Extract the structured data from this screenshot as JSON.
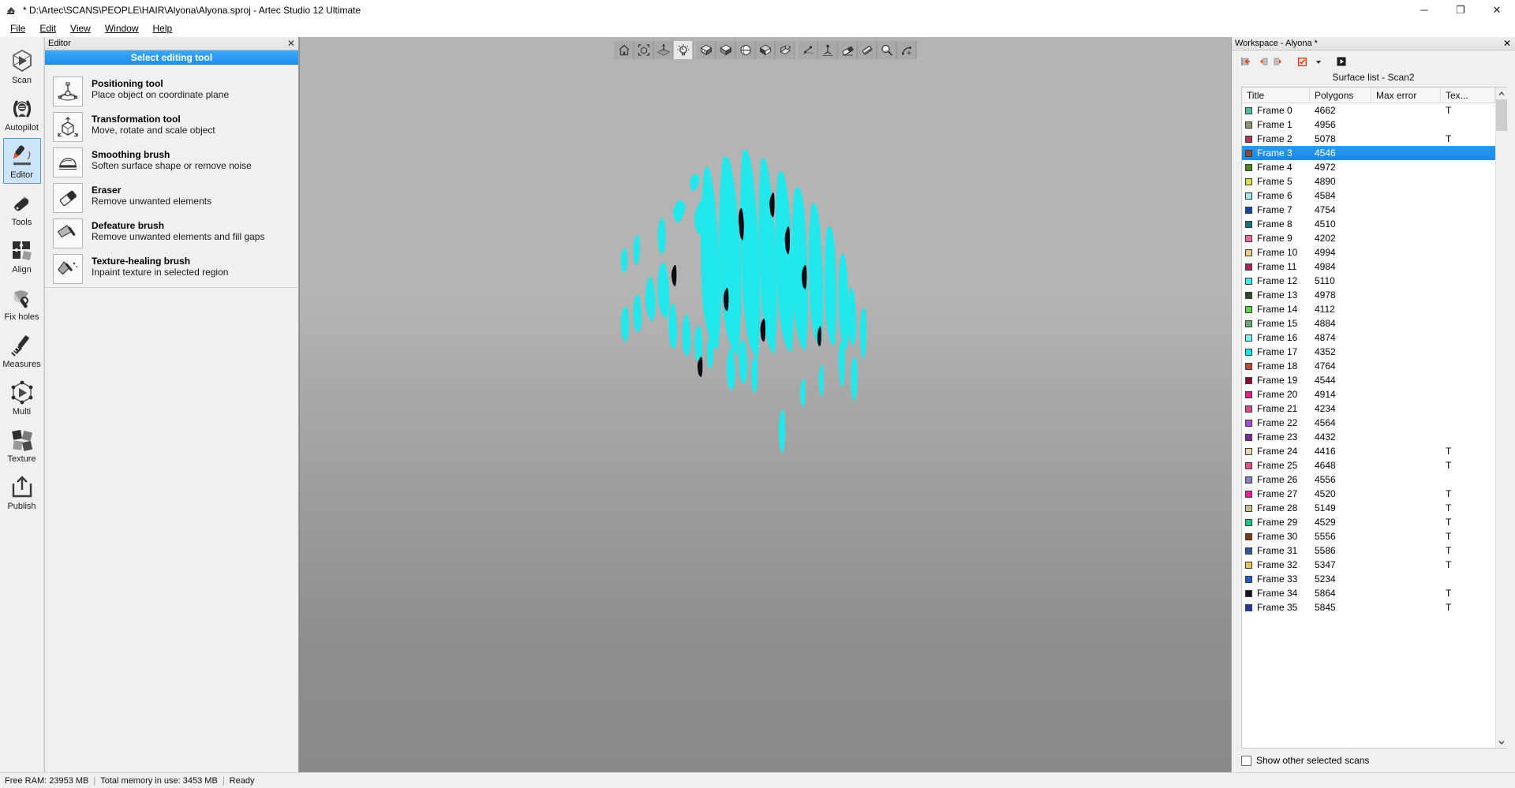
{
  "window": {
    "title": "* D:\\Artec\\SCANS\\PEOPLE\\HAIR\\Alyona\\Alyona.sproj - Artec Studio 12 Ultimate",
    "minimize_label": "─",
    "maximize_label": "❐",
    "close_label": "✕"
  },
  "menu": {
    "items": [
      {
        "label": "File"
      },
      {
        "label": "Edit"
      },
      {
        "label": "View"
      },
      {
        "label": "Window"
      },
      {
        "label": "Help"
      }
    ]
  },
  "rail": {
    "items": [
      {
        "label": "Scan",
        "icon": "scan-icon",
        "active": false
      },
      {
        "label": "Autopilot",
        "icon": "autopilot-icon",
        "active": false
      },
      {
        "label": "Editor",
        "icon": "editor-icon",
        "active": true
      },
      {
        "label": "Tools",
        "icon": "tools-icon",
        "active": false
      },
      {
        "label": "Align",
        "icon": "align-icon",
        "active": false
      },
      {
        "label": "Fix holes",
        "icon": "fix-holes-icon",
        "active": false
      },
      {
        "label": "Measures",
        "icon": "measures-icon",
        "active": false
      },
      {
        "label": "Multi",
        "icon": "multi-icon",
        "active": false
      },
      {
        "label": "Texture",
        "icon": "texture-icon",
        "active": false
      },
      {
        "label": "Publish",
        "icon": "publish-icon",
        "active": false
      }
    ]
  },
  "editor_panel": {
    "caption": "Editor",
    "close_label": "✕",
    "section_title": "Select editing tool",
    "tools": [
      {
        "title": "Positioning tool",
        "desc": "Place object on coordinate plane",
        "icon": "positioning-tool-icon"
      },
      {
        "title": "Transformation tool",
        "desc": "Move, rotate and scale object",
        "icon": "transformation-tool-icon"
      },
      {
        "title": "Smoothing brush",
        "desc": "Soften surface shape or remove noise",
        "icon": "smoothing-brush-icon"
      },
      {
        "title": "Eraser",
        "desc": "Remove unwanted elements",
        "icon": "eraser-icon"
      },
      {
        "title": "Defeature brush",
        "desc": "Remove unwanted elements and fill gaps",
        "icon": "defeature-brush-icon"
      },
      {
        "title": "Texture-healing brush",
        "desc": "Inpaint texture in selected region",
        "icon": "texture-healing-brush-icon"
      }
    ]
  },
  "viewport": {
    "toolbar": [
      {
        "icon": "home-view-icon",
        "active": false
      },
      {
        "icon": "fit-to-view-icon",
        "active": false
      },
      {
        "icon": "grid-axes-icon",
        "active": false
      },
      {
        "icon": "lighting-icon",
        "active": true
      },
      {
        "icon": "render-textured-icon",
        "active": false
      },
      {
        "icon": "render-solid-icon",
        "active": false
      },
      {
        "icon": "render-sphere-icon",
        "active": false
      },
      {
        "icon": "render-shaded-icon",
        "active": false
      },
      {
        "icon": "section-plane-icon",
        "active": false
      },
      {
        "icon": "measure-point-icon",
        "active": false
      },
      {
        "icon": "measure-dist-icon",
        "active": false
      },
      {
        "icon": "eraser-tool-icon",
        "active": false
      },
      {
        "icon": "rubber-tool-icon",
        "active": false
      },
      {
        "icon": "magnifier-icon",
        "active": false
      },
      {
        "icon": "sculpt-icon",
        "active": false
      }
    ],
    "model_color": "#22e8ec"
  },
  "workspace": {
    "caption": "Workspace - Alyona *",
    "close_label": "✕",
    "toolbar": [
      {
        "icon": "jump-to-start-icon"
      },
      {
        "icon": "step-back-icon"
      },
      {
        "icon": "step-forward-icon"
      },
      {
        "icon": "check-all-icon"
      },
      {
        "icon": "dropdown-arrow-icon"
      },
      {
        "icon": "play-icon"
      }
    ],
    "subtitle": "Surface list - Scan2",
    "columns": [
      "Title",
      "Polygons",
      "Max error",
      "Tex..."
    ],
    "footer_checkbox_label": "Show other selected scans",
    "footer_checkbox_checked": false,
    "selected_row_index": 3,
    "rows": [
      {
        "color": "#4bbfa8",
        "title": "Frame 0",
        "polygons": "4662",
        "max_error": "",
        "tex": "T"
      },
      {
        "color": "#8a9a6a",
        "title": "Frame 1",
        "polygons": "4956",
        "max_error": "",
        "tex": ""
      },
      {
        "color": "#a83e52",
        "title": "Frame 2",
        "polygons": "5078",
        "max_error": "",
        "tex": "T"
      },
      {
        "color": "#8c4a3c",
        "title": "Frame 3",
        "polygons": "4546",
        "max_error": "",
        "tex": ""
      },
      {
        "color": "#4a8c14",
        "title": "Frame 4",
        "polygons": "4972",
        "max_error": "",
        "tex": ""
      },
      {
        "color": "#dde04c",
        "title": "Frame 5",
        "polygons": "4890",
        "max_error": "",
        "tex": ""
      },
      {
        "color": "#9ae8f2",
        "title": "Frame 6",
        "polygons": "4584",
        "max_error": "",
        "tex": ""
      },
      {
        "color": "#1646a8",
        "title": "Frame 7",
        "polygons": "4754",
        "max_error": "",
        "tex": ""
      },
      {
        "color": "#1b6f86",
        "title": "Frame 8",
        "polygons": "4510",
        "max_error": "",
        "tex": ""
      },
      {
        "color": "#ef6aa0",
        "title": "Frame 9",
        "polygons": "4202",
        "max_error": "",
        "tex": ""
      },
      {
        "color": "#e8cc8c",
        "title": "Frame 10",
        "polygons": "4994",
        "max_error": "",
        "tex": ""
      },
      {
        "color": "#b01f58",
        "title": "Frame 11",
        "polygons": "4984",
        "max_error": "",
        "tex": ""
      },
      {
        "color": "#3cf0f0",
        "title": "Frame 12",
        "polygons": "5110",
        "max_error": "",
        "tex": ""
      },
      {
        "color": "#2c4a2c",
        "title": "Frame 13",
        "polygons": "4978",
        "max_error": "",
        "tex": ""
      },
      {
        "color": "#5cd44c",
        "title": "Frame 14",
        "polygons": "4112",
        "max_error": "",
        "tex": ""
      },
      {
        "color": "#6fa86f",
        "title": "Frame 15",
        "polygons": "4884",
        "max_error": "",
        "tex": ""
      },
      {
        "color": "#7cf0f0",
        "title": "Frame 16",
        "polygons": "4874",
        "max_error": "",
        "tex": ""
      },
      {
        "color": "#16e8e8",
        "title": "Frame 17",
        "polygons": "4352",
        "max_error": "",
        "tex": ""
      },
      {
        "color": "#bf4a3a",
        "title": "Frame 18",
        "polygons": "4764",
        "max_error": "",
        "tex": ""
      },
      {
        "color": "#8c0a2a",
        "title": "Frame 19",
        "polygons": "4544",
        "max_error": "",
        "tex": ""
      },
      {
        "color": "#e81e8c",
        "title": "Frame 20",
        "polygons": "4914",
        "max_error": "",
        "tex": ""
      },
      {
        "color": "#d44c8c",
        "title": "Frame 21",
        "polygons": "4234",
        "max_error": "",
        "tex": ""
      },
      {
        "color": "#a84cd4",
        "title": "Frame 22",
        "polygons": "4564",
        "max_error": "",
        "tex": ""
      },
      {
        "color": "#7a2a9a",
        "title": "Frame 23",
        "polygons": "4432",
        "max_error": "",
        "tex": ""
      },
      {
        "color": "#e8d8b0",
        "title": "Frame 24",
        "polygons": "4416",
        "max_error": "",
        "tex": "T"
      },
      {
        "color": "#e8547c",
        "title": "Frame 25",
        "polygons": "4648",
        "max_error": "",
        "tex": "T"
      },
      {
        "color": "#8c7cc4",
        "title": "Frame 26",
        "polygons": "4556",
        "max_error": "",
        "tex": ""
      },
      {
        "color": "#f01e9a",
        "title": "Frame 27",
        "polygons": "4520",
        "max_error": "",
        "tex": "T"
      },
      {
        "color": "#c4c490",
        "title": "Frame 28",
        "polygons": "5149",
        "max_error": "",
        "tex": "T"
      },
      {
        "color": "#14c490",
        "title": "Frame 29",
        "polygons": "4529",
        "max_error": "",
        "tex": "T"
      },
      {
        "color": "#7a3c14",
        "title": "Frame 30",
        "polygons": "5556",
        "max_error": "",
        "tex": "T"
      },
      {
        "color": "#2a5c9a",
        "title": "Frame 31",
        "polygons": "5586",
        "max_error": "",
        "tex": "T"
      },
      {
        "color": "#e8c454",
        "title": "Frame 32",
        "polygons": "5347",
        "max_error": "",
        "tex": "T"
      },
      {
        "color": "#1e5cc4",
        "title": "Frame 33",
        "polygons": "5234",
        "max_error": "",
        "tex": ""
      },
      {
        "color": "#141428",
        "title": "Frame 34",
        "polygons": "5864",
        "max_error": "",
        "tex": "T"
      },
      {
        "color": "#1e3ca8",
        "title": "Frame 35",
        "polygons": "5845",
        "max_error": "",
        "tex": "T"
      }
    ]
  },
  "statusbar": {
    "free_ram": "Free RAM: 23953 MB",
    "total_memory": "Total memory in use: 3453 MB",
    "state": "Ready",
    "separator": "|"
  }
}
